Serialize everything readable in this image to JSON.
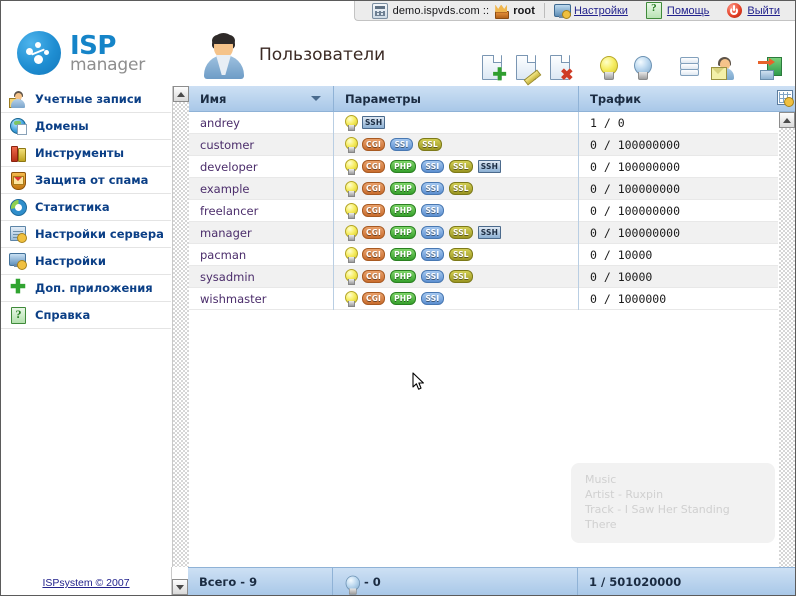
{
  "topbar": {
    "server": "demo.ispvds.com ::",
    "user": "root",
    "settings_label": "Настройки",
    "help_label": "Помощь",
    "logout_label": "Выйти"
  },
  "brand": {
    "isp": "ISP",
    "manager": "manager"
  },
  "page": {
    "title": "Пользователи"
  },
  "toolbar": {
    "buttons": [
      {
        "name": "new-user",
        "icon": "document-add-icon"
      },
      {
        "name": "edit-user",
        "icon": "document-edit-icon"
      },
      {
        "name": "delete-user",
        "icon": "document-delete-icon"
      },
      {
        "name": "enable-user",
        "icon": "bulb-on-icon"
      },
      {
        "name": "disable-user",
        "icon": "bulb-off-icon"
      },
      {
        "name": "user-logs",
        "icon": "stack-icon"
      },
      {
        "name": "user-mail",
        "icon": "user-mail-icon"
      },
      {
        "name": "enter-as-user",
        "icon": "exit-door-icon"
      }
    ]
  },
  "sidebar": {
    "items": [
      {
        "label": "Учетные записи",
        "icon": "account-icon"
      },
      {
        "label": "Домены",
        "icon": "domain-globe-icon"
      },
      {
        "label": "Инструменты",
        "icon": "tools-icon"
      },
      {
        "label": "Защита от спама",
        "icon": "spam-shield-icon"
      },
      {
        "label": "Статистика",
        "icon": "statistics-pie-icon"
      },
      {
        "label": "Настройки сервера",
        "icon": "server-settings-icon"
      },
      {
        "label": "Настройки",
        "icon": "settings-monitor-icon"
      },
      {
        "label": "Доп. приложения",
        "icon": "plus-icon"
      },
      {
        "label": "Справка",
        "icon": "help-book-icon"
      }
    ],
    "copyright": "ISPsystem © 2007"
  },
  "table": {
    "columns": [
      {
        "label": "Имя",
        "sorted": true
      },
      {
        "label": "Параметры",
        "sorted": false
      },
      {
        "label": "Трафик",
        "sorted": false
      }
    ],
    "rows": [
      {
        "name": "andrey",
        "params": [
          "SSH"
        ],
        "traffic": "1 / 0"
      },
      {
        "name": "customer",
        "params": [
          "CGI",
          "SSI",
          "SSL"
        ],
        "traffic": "0 / 100000000"
      },
      {
        "name": "developer",
        "params": [
          "CGI",
          "PHP",
          "SSI",
          "SSL",
          "SSH"
        ],
        "traffic": "0 / 100000000"
      },
      {
        "name": "example",
        "params": [
          "CGI",
          "PHP",
          "SSI",
          "SSL"
        ],
        "traffic": "0 / 100000000"
      },
      {
        "name": "freelancer",
        "params": [
          "CGI",
          "PHP",
          "SSI"
        ],
        "traffic": "0 / 100000000"
      },
      {
        "name": "manager",
        "params": [
          "CGI",
          "PHP",
          "SSI",
          "SSL",
          "SSH"
        ],
        "traffic": "0 / 100000000"
      },
      {
        "name": "pacman",
        "params": [
          "CGI",
          "PHP",
          "SSI",
          "SSL"
        ],
        "traffic": "0 / 10000"
      },
      {
        "name": "sysadmin",
        "params": [
          "CGI",
          "PHP",
          "SSI",
          "SSL"
        ],
        "traffic": "0 / 10000"
      },
      {
        "name": "wishmaster",
        "params": [
          "CGI",
          "PHP",
          "SSI"
        ],
        "traffic": "0 / 1000000"
      }
    ]
  },
  "footer": {
    "total": "Всего - 9",
    "bulb_count": "- 0",
    "traffic_total": "1 / 501020000"
  },
  "music_overlay": {
    "line1": "Music",
    "line2": "Artist - Ruxpin",
    "line3": "Track - I Saw Her Standing There"
  },
  "colors": {
    "header_blue": "#a9c8e8",
    "brand_blue": "#1584c8",
    "link": "#22228c",
    "row_alt": "#f1f1f1",
    "username": "#4b2d6b"
  }
}
